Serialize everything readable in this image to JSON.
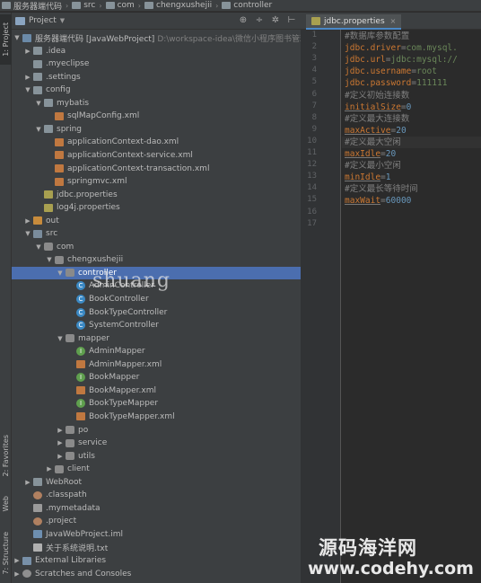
{
  "breadcrumb": [
    "服务器端代码",
    "src",
    "com",
    "chengxushejii",
    "controller"
  ],
  "left_tool_tabs": {
    "project": "1: Project",
    "favorites": "2: Favorites",
    "web": "Web",
    "structure": "7: Structure"
  },
  "project_panel": {
    "title": "Project",
    "icons": [
      "globe-icon",
      "split-icon",
      "gear-icon",
      "hide-icon"
    ]
  },
  "tree": [
    {
      "label": "服务器端代码 [JavaWebProject]",
      "extra": "D:\\workspace-idea\\微信小程序图书管理系",
      "arrow": "down",
      "icon": "module"
    },
    {
      "label": ".idea",
      "arrow": "right",
      "icon": "folder"
    },
    {
      "label": ".myeclipse",
      "arrow": "",
      "icon": "folder"
    },
    {
      "label": ".settings",
      "arrow": "right",
      "icon": "folder"
    },
    {
      "label": "config",
      "arrow": "down",
      "icon": "folder"
    },
    {
      "label": "mybatis",
      "arrow": "down",
      "icon": "folder"
    },
    {
      "label": "sqlMapConfig.xml",
      "arrow": "",
      "icon": "xml"
    },
    {
      "label": "spring",
      "arrow": "down",
      "icon": "folder"
    },
    {
      "label": "applicationContext-dao.xml",
      "arrow": "",
      "icon": "xml"
    },
    {
      "label": "applicationContext-service.xml",
      "arrow": "",
      "icon": "xml"
    },
    {
      "label": "applicationContext-transaction.xml",
      "arrow": "",
      "icon": "xml"
    },
    {
      "label": "springmvc.xml",
      "arrow": "",
      "icon": "xml"
    },
    {
      "label": "jdbc.properties",
      "arrow": "",
      "icon": "prop"
    },
    {
      "label": "log4j.properties",
      "arrow": "",
      "icon": "prop"
    },
    {
      "label": "out",
      "arrow": "right",
      "icon": "folder-orange"
    },
    {
      "label": "src",
      "arrow": "down",
      "icon": "folder-src"
    },
    {
      "label": "com",
      "arrow": "down",
      "icon": "pkg"
    },
    {
      "label": "chengxushejii",
      "arrow": "down",
      "icon": "pkg"
    },
    {
      "label": "controller",
      "arrow": "down",
      "icon": "pkg",
      "selected": true
    },
    {
      "label": "AdminController",
      "arrow": "",
      "icon": "cls"
    },
    {
      "label": "BookController",
      "arrow": "",
      "icon": "cls"
    },
    {
      "label": "BookTypeController",
      "arrow": "",
      "icon": "cls"
    },
    {
      "label": "SystemController",
      "arrow": "",
      "icon": "cls"
    },
    {
      "label": "mapper",
      "arrow": "down",
      "icon": "pkg"
    },
    {
      "label": "AdminMapper",
      "arrow": "",
      "icon": "iface"
    },
    {
      "label": "AdminMapper.xml",
      "arrow": "",
      "icon": "xml"
    },
    {
      "label": "BookMapper",
      "arrow": "",
      "icon": "iface"
    },
    {
      "label": "BookMapper.xml",
      "arrow": "",
      "icon": "xml"
    },
    {
      "label": "BookTypeMapper",
      "arrow": "",
      "icon": "iface"
    },
    {
      "label": "BookTypeMapper.xml",
      "arrow": "",
      "icon": "xml"
    },
    {
      "label": "po",
      "arrow": "right",
      "icon": "pkg"
    },
    {
      "label": "service",
      "arrow": "right",
      "icon": "pkg"
    },
    {
      "label": "utils",
      "arrow": "right",
      "icon": "pkg"
    },
    {
      "label": "client",
      "arrow": "right",
      "icon": "pkg"
    },
    {
      "label": "WebRoot",
      "arrow": "right",
      "icon": "folder"
    },
    {
      "label": ".classpath",
      "arrow": "",
      "icon": "dot"
    },
    {
      "label": ".mymetadata",
      "arrow": "",
      "icon": "file"
    },
    {
      "label": ".project",
      "arrow": "",
      "icon": "dot"
    },
    {
      "label": "JavaWebProject.iml",
      "arrow": "",
      "icon": "iml"
    },
    {
      "label": "关于系统说明.txt",
      "arrow": "",
      "icon": "txt"
    },
    {
      "label": "External Libraries",
      "arrow": "right",
      "icon": "lib"
    },
    {
      "label": "Scratches and Consoles",
      "arrow": "right",
      "icon": "scratch"
    }
  ],
  "editor": {
    "tab_label": "jdbc.properties",
    "line_numbers": [
      "1",
      "2",
      "3",
      "4",
      "5",
      "6",
      "7",
      "8",
      "9",
      "10",
      "11",
      "12",
      "13",
      "14",
      "15",
      "16",
      "17"
    ],
    "lines": [
      {
        "type": "comment",
        "text": "#数据库参数配置"
      },
      {
        "type": "kv",
        "key": "jdbc.driver",
        "value": "com.mysql."
      },
      {
        "type": "kv",
        "key": "jdbc.url",
        "value": "jdbc:mysql://"
      },
      {
        "type": "kv",
        "key": "jdbc.username",
        "value": "root"
      },
      {
        "type": "kv",
        "key": "jdbc.password",
        "value": "111111"
      },
      {
        "type": "comment",
        "text": "#定义初始连接数"
      },
      {
        "type": "kvu",
        "key": "initialSize",
        "value": "0"
      },
      {
        "type": "comment",
        "text": "#定义最大连接数"
      },
      {
        "type": "kvu",
        "key": "maxActive",
        "value": "20"
      },
      {
        "type": "comment",
        "text": "#定义最大空闲",
        "current": true
      },
      {
        "type": "kvu",
        "key": "maxIdle",
        "value": "20"
      },
      {
        "type": "comment",
        "text": "#定义最小空闲"
      },
      {
        "type": "kvu",
        "key": "minIdle",
        "value": "1"
      },
      {
        "type": "comment",
        "text": "#定义最长等待时间"
      },
      {
        "type": "kvu",
        "key": "maxWait",
        "value": "60000"
      },
      {
        "type": "empty",
        "text": ""
      },
      {
        "type": "empty",
        "text": ""
      }
    ]
  },
  "watermarks": {
    "center": "shuang",
    "brand": "源码海洋网",
    "url": "www.codehy.com"
  }
}
